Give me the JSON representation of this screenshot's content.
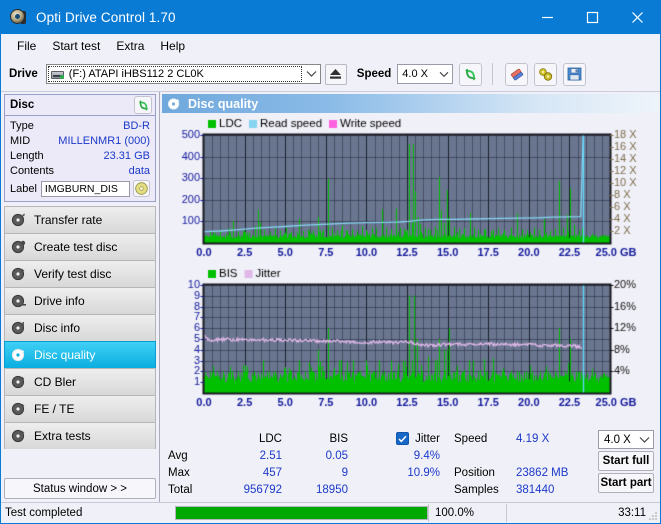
{
  "window": {
    "title": "Opti Drive Control 1.70",
    "icon": "disc-icon",
    "controls": {
      "minimize": "minimize-icon",
      "maximize": "maximize-icon",
      "close": "close-icon"
    }
  },
  "menubar": {
    "items": [
      "File",
      "Start test",
      "Extra",
      "Help"
    ]
  },
  "toolbar": {
    "drive_label": "Drive",
    "drive_value": "(F:)   ATAPI iHBS112  2 CL0K",
    "eject_icon": "eject-icon",
    "speed_label": "Speed",
    "speed_value": "4.0 X",
    "refresh_icon": "refresh-icon",
    "erase_icon": "eraser-icon",
    "tools_icon": "wrench-icon",
    "save_icon": "save-icon"
  },
  "disc_panel": {
    "title": "Disc",
    "refresh_icon": "refresh-icon",
    "rows": [
      {
        "key": "Type",
        "value": "BD-R"
      },
      {
        "key": "MID",
        "value": "MILLENMR1 (000)"
      },
      {
        "key": "Length",
        "value": "23.31 GB"
      },
      {
        "key": "Contents",
        "value": "data"
      }
    ],
    "label_key": "Label",
    "label_value": "IMGBURN_DIS",
    "label_icon": "disc-icon"
  },
  "sidebar": {
    "items": [
      {
        "label": "Transfer rate",
        "icon": "disc-icon",
        "active": false
      },
      {
        "label": "Create test disc",
        "icon": "disc-icon",
        "active": false
      },
      {
        "label": "Verify test disc",
        "icon": "disc-icon",
        "active": false
      },
      {
        "label": "Drive info",
        "icon": "disc-icon",
        "active": false
      },
      {
        "label": "Disc info",
        "icon": "disc-icon",
        "active": false
      },
      {
        "label": "Disc quality",
        "icon": "disc-icon",
        "active": true
      },
      {
        "label": "CD Bler",
        "icon": "disc-icon",
        "active": false
      },
      {
        "label": "FE / TE",
        "icon": "disc-icon",
        "active": false
      },
      {
        "label": "Extra tests",
        "icon": "disc-icon",
        "active": false
      }
    ],
    "status_button": "Status window > >"
  },
  "content": {
    "header_title": "Disc quality",
    "header_icon": "disc-quality-icon"
  },
  "stats": {
    "col_headers": [
      "LDC",
      "BIS"
    ],
    "jitter_label": "Jitter",
    "jitter_checked": true,
    "rows": [
      {
        "name": "Avg",
        "ldc": "2.51",
        "bis": "0.05",
        "jitter": "9.4%"
      },
      {
        "name": "Max",
        "ldc": "457",
        "bis": "9",
        "jitter": "10.9%"
      },
      {
        "name": "Total",
        "ldc": "956792",
        "bis": "18950",
        "jitter": ""
      }
    ],
    "speed_key": "Speed",
    "speed_value": "4.19 X",
    "position_key": "Position",
    "position_value": "23862 MB",
    "samples_key": "Samples",
    "samples_value": "381440",
    "speed_select": "4.0 X",
    "start_full": "Start full",
    "start_part": "Start part"
  },
  "statusbar": {
    "text": "Test completed",
    "percent": "100.0%",
    "progress": 100,
    "time": "33:11"
  },
  "colors": {
    "accent": "#0a7bd5",
    "value_blue": "#1b39c8",
    "ldc_green": "#00c000",
    "read_speed": "#86d4f2",
    "write_speed": "#ff60e0",
    "jitter_pink": "#e0b8e8",
    "plot_bg": "#6a7690",
    "progress_green": "#00a800",
    "right_axis_top": "#8a7a5a"
  },
  "chart_data": [
    {
      "type": "line",
      "title": "Disc quality - LDC / Read speed",
      "xlabel": "GB",
      "ylabel": "LDC",
      "xlim": [
        0,
        25
      ],
      "ylim": [
        0,
        500
      ],
      "y2lim": [
        0,
        18
      ],
      "y2label": "X",
      "xticks": [
        "0.0",
        "2.5",
        "5.0",
        "7.5",
        "10.0",
        "12.5",
        "15.0",
        "17.5",
        "20.0",
        "22.5",
        "25.0 GB"
      ],
      "yticks": [
        100,
        200,
        300,
        400,
        500
      ],
      "y2ticks": [
        "2 X",
        "4 X",
        "6 X",
        "8 X",
        "10 X",
        "12 X",
        "14 X",
        "16 X",
        "18 X"
      ],
      "grid": true,
      "legend_position": "top-left",
      "legend": [
        {
          "name": "LDC",
          "color": "#00c000"
        },
        {
          "name": "Read speed",
          "color": "#86d4f2"
        },
        {
          "name": "Write speed",
          "color": "#ff60e0"
        }
      ],
      "series": [
        {
          "name": "LDC",
          "color": "#00c000",
          "kind": "spikes",
          "baseline": 22,
          "noise": 18,
          "spikes": [
            [
              0.35,
              55
            ],
            [
              0.7,
              48
            ],
            [
              1.0,
              62
            ],
            [
              1.35,
              44
            ],
            [
              1.55,
              70
            ],
            [
              1.8,
              103
            ],
            [
              2.1,
              52
            ],
            [
              2.45,
              60
            ],
            [
              2.8,
              48
            ],
            [
              3.15,
              78
            ],
            [
              3.35,
              155
            ],
            [
              3.45,
              95
            ],
            [
              3.7,
              60
            ],
            [
              4.05,
              52
            ],
            [
              4.35,
              66
            ],
            [
              4.7,
              58
            ],
            [
              5.05,
              70
            ],
            [
              5.35,
              52
            ],
            [
              5.7,
              50
            ],
            [
              5.85,
              112
            ],
            [
              6.1,
              56
            ],
            [
              6.4,
              64
            ],
            [
              6.7,
              58
            ],
            [
              7.0,
              120
            ],
            [
              7.3,
              62
            ],
            [
              7.62,
              298
            ],
            [
              7.9,
              70
            ],
            [
              8.2,
              58
            ],
            [
              8.5,
              82
            ],
            [
              8.75,
              60
            ],
            [
              9.1,
              66
            ],
            [
              9.4,
              56
            ],
            [
              9.7,
              78
            ],
            [
              10.0,
              60
            ],
            [
              10.35,
              72
            ],
            [
              10.6,
              68
            ],
            [
              10.95,
              156
            ],
            [
              11.2,
              70
            ],
            [
              11.5,
              64
            ],
            [
              11.8,
              160
            ],
            [
              12.05,
              72
            ],
            [
              12.3,
              66
            ],
            [
              12.5,
              60
            ],
            [
              12.62,
              458
            ],
            [
              12.78,
              92
            ],
            [
              12.9,
              458
            ],
            [
              13.0,
              240
            ],
            [
              13.15,
              120
            ],
            [
              13.3,
              88
            ],
            [
              13.6,
              70
            ],
            [
              13.9,
              62
            ],
            [
              14.2,
              76
            ],
            [
              14.45,
              305
            ],
            [
              14.6,
              150
            ],
            [
              14.75,
              92
            ],
            [
              14.95,
              245
            ],
            [
              15.1,
              120
            ],
            [
              15.4,
              74
            ],
            [
              15.7,
              66
            ],
            [
              16.0,
              70
            ],
            [
              16.35,
              140
            ],
            [
              16.6,
              72
            ],
            [
              16.9,
              60
            ],
            [
              17.3,
              64
            ],
            [
              17.7,
              56
            ],
            [
              18.1,
              68
            ],
            [
              18.5,
              60
            ],
            [
              18.9,
              72
            ],
            [
              19.3,
              138
            ],
            [
              19.6,
              64
            ],
            [
              19.9,
              58
            ],
            [
              20.3,
              70
            ],
            [
              20.6,
              62
            ],
            [
              20.95,
              110
            ],
            [
              21.3,
              58
            ],
            [
              21.6,
              66
            ],
            [
              21.85,
              288
            ],
            [
              22.1,
              72
            ],
            [
              22.35,
              130
            ],
            [
              22.55,
              253
            ],
            [
              22.8,
              84
            ],
            [
              23.1,
              60
            ],
            [
              23.25,
              70
            ]
          ]
        },
        {
          "name": "Read speed",
          "color": "#86d4f2",
          "kind": "line",
          "points": [
            [
              0.0,
              1.9
            ],
            [
              1.0,
              2.0
            ],
            [
              2.0,
              2.2
            ],
            [
              3.0,
              2.45
            ],
            [
              4.0,
              2.6
            ],
            [
              5.0,
              2.75
            ],
            [
              6.0,
              2.95
            ],
            [
              7.0,
              3.05
            ],
            [
              8.0,
              3.2
            ],
            [
              9.0,
              3.3
            ],
            [
              10.0,
              3.4
            ],
            [
              11.0,
              3.45
            ],
            [
              12.0,
              3.5
            ],
            [
              12.6,
              3.6
            ],
            [
              13.5,
              3.85
            ],
            [
              14.5,
              3.95
            ],
            [
              15.5,
              3.95
            ],
            [
              16.5,
              4.0
            ],
            [
              17.5,
              4.05
            ],
            [
              18.5,
              4.1
            ],
            [
              19.5,
              4.15
            ],
            [
              20.5,
              4.2
            ],
            [
              21.5,
              4.3
            ],
            [
              22.5,
              4.35
            ],
            [
              23.2,
              4.4
            ],
            [
              23.35,
              18.0
            ]
          ]
        }
      ]
    },
    {
      "type": "line",
      "title": "Disc quality - BIS / Jitter",
      "xlabel": "GB",
      "ylabel": "BIS",
      "xlim": [
        0,
        25
      ],
      "ylim": [
        0,
        10
      ],
      "y2lim": [
        0,
        20
      ],
      "y2label": "%",
      "xticks": [
        "0.0",
        "2.5",
        "5.0",
        "7.5",
        "10.0",
        "12.5",
        "15.0",
        "17.5",
        "20.0",
        "22.5",
        "25.0 GB"
      ],
      "yticks": [
        1,
        2,
        3,
        4,
        5,
        6,
        7,
        8,
        9,
        10
      ],
      "y2ticks": [
        "4%",
        "8%",
        "12%",
        "16%",
        "20%"
      ],
      "grid": true,
      "legend_position": "top-left",
      "legend": [
        {
          "name": "BIS",
          "color": "#00c000"
        },
        {
          "name": "Jitter",
          "color": "#e0b8e8"
        }
      ],
      "series": [
        {
          "name": "BIS",
          "color": "#00c000",
          "kind": "spikes",
          "baseline": 1.0,
          "noise": 1.0,
          "spikes": [
            [
              0.4,
              2
            ],
            [
              0.8,
              2
            ],
            [
              1.2,
              2
            ],
            [
              1.7,
              2
            ],
            [
              2.1,
              2
            ],
            [
              2.6,
              2
            ],
            [
              3.1,
              2
            ],
            [
              3.65,
              3
            ],
            [
              4.0,
              2
            ],
            [
              4.4,
              2
            ],
            [
              4.9,
              2
            ],
            [
              5.3,
              2
            ],
            [
              5.85,
              3
            ],
            [
              6.2,
              2
            ],
            [
              6.7,
              2
            ],
            [
              7.05,
              4
            ],
            [
              7.4,
              2
            ],
            [
              7.62,
              6
            ],
            [
              7.95,
              2
            ],
            [
              8.3,
              3
            ],
            [
              8.7,
              2
            ],
            [
              9.2,
              3
            ],
            [
              9.6,
              2
            ],
            [
              10.0,
              3
            ],
            [
              10.4,
              2
            ],
            [
              10.8,
              3
            ],
            [
              11.1,
              2
            ],
            [
              11.5,
              3
            ],
            [
              11.9,
              2
            ],
            [
              12.25,
              3
            ],
            [
              12.45,
              2
            ],
            [
              12.62,
              9
            ],
            [
              12.8,
              3
            ],
            [
              12.95,
              9
            ],
            [
              13.1,
              5
            ],
            [
              13.4,
              2
            ],
            [
              13.8,
              2
            ],
            [
              14.2,
              3
            ],
            [
              14.45,
              5
            ],
            [
              14.75,
              4
            ],
            [
              14.95,
              4
            ],
            [
              15.1,
              6
            ],
            [
              15.5,
              2
            ],
            [
              15.9,
              2
            ],
            [
              16.3,
              3
            ],
            [
              16.55,
              3
            ],
            [
              16.9,
              2
            ],
            [
              17.4,
              2
            ],
            [
              17.9,
              2
            ],
            [
              18.4,
              2
            ],
            [
              18.9,
              2
            ],
            [
              19.3,
              2
            ],
            [
              19.8,
              2
            ],
            [
              20.2,
              2
            ],
            [
              20.7,
              2
            ],
            [
              21.2,
              2
            ],
            [
              21.6,
              2
            ],
            [
              21.85,
              6
            ],
            [
              22.2,
              2
            ],
            [
              22.55,
              5
            ],
            [
              22.9,
              2
            ],
            [
              23.2,
              2
            ]
          ]
        },
        {
          "name": "Jitter",
          "color": "#e0b8e8",
          "kind": "line",
          "points": [
            [
              0.0,
              5.35
            ],
            [
              0.3,
              4.9
            ],
            [
              1.0,
              4.95
            ],
            [
              2.0,
              4.95
            ],
            [
              3.0,
              4.95
            ],
            [
              4.0,
              4.9
            ],
            [
              5.0,
              4.9
            ],
            [
              6.0,
              4.85
            ],
            [
              7.0,
              4.8
            ],
            [
              8.0,
              4.8
            ],
            [
              9.0,
              4.75
            ],
            [
              10.0,
              4.7
            ],
            [
              11.0,
              4.7
            ],
            [
              12.0,
              4.65
            ],
            [
              12.6,
              4.75
            ],
            [
              13.0,
              4.6
            ],
            [
              13.6,
              4.4
            ],
            [
              14.3,
              4.45
            ],
            [
              15.0,
              4.5
            ],
            [
              16.0,
              4.5
            ],
            [
              17.0,
              4.5
            ],
            [
              18.0,
              4.5
            ],
            [
              19.0,
              4.5
            ],
            [
              20.0,
              4.5
            ],
            [
              20.8,
              4.4
            ],
            [
              21.6,
              4.4
            ],
            [
              22.4,
              4.38
            ],
            [
              23.1,
              4.3
            ],
            [
              23.3,
              4.3
            ]
          ]
        }
      ]
    }
  ]
}
